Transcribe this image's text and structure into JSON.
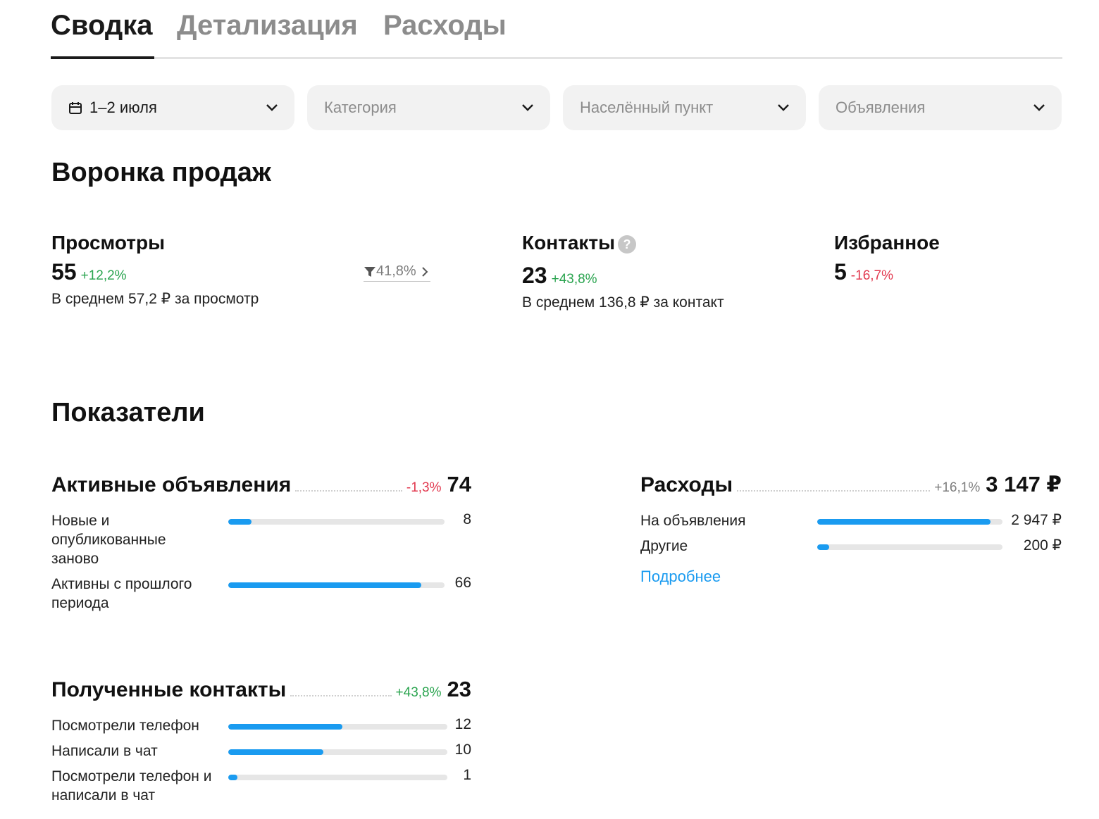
{
  "tabs": [
    {
      "label": "Сводка",
      "active": true
    },
    {
      "label": "Детализация",
      "active": false
    },
    {
      "label": "Расходы",
      "active": false
    }
  ],
  "filters": {
    "date": "1–2 июля",
    "category": "Категория",
    "city": "Населённый пункт",
    "ads": "Объявления"
  },
  "funnel": {
    "title": "Воронка продаж",
    "views": {
      "title": "Просмотры",
      "value": "55",
      "delta": "+12,2%",
      "sub": "В среднем 57,2 ₽ за просмотр",
      "conversion": "41,8%"
    },
    "contacts": {
      "title": "Контакты",
      "help": "?",
      "value": "23",
      "delta": "+43,8%",
      "sub": "В среднем 136,8 ₽ за контакт"
    },
    "favorites": {
      "title": "Избранное",
      "value": "5",
      "delta": "-16,7%"
    }
  },
  "indicators": {
    "title": "Показатели",
    "active_ads": {
      "title": "Активные объявления",
      "delta": "-1,3%",
      "value": "74",
      "rows": [
        {
          "label": "Новые и опубликованные заново",
          "value": "8",
          "fraction": 0.108
        },
        {
          "label": "Активны с прошлого периода",
          "value": "66",
          "fraction": 0.892
        }
      ]
    },
    "expenses": {
      "title": "Расходы",
      "delta": "+16,1%",
      "value": "3 147 ₽",
      "rows": [
        {
          "label": "На объявления",
          "value": "2 947 ₽",
          "fraction": 0.936
        },
        {
          "label": "Другие",
          "value": "200 ₽",
          "fraction": 0.064
        }
      ],
      "link": "Подробнее"
    },
    "contacts_received": {
      "title": "Полученные контакты",
      "delta": "+43,8%",
      "value": "23",
      "rows": [
        {
          "label": "Посмотрели телефон",
          "value": "12",
          "fraction": 0.522
        },
        {
          "label": "Написали в чат",
          "value": "10",
          "fraction": 0.435
        },
        {
          "label": "Посмотрели телефон и написали в чат",
          "value": "1",
          "fraction": 0.043
        }
      ]
    }
  },
  "colors": {
    "accent": "#1a9bf0",
    "positive": "#2aa44f",
    "negative": "#e2394f"
  },
  "icons": [
    "calendar-icon",
    "chevron-down-icon",
    "filter-icon",
    "chevron-right-icon",
    "help-icon"
  ]
}
